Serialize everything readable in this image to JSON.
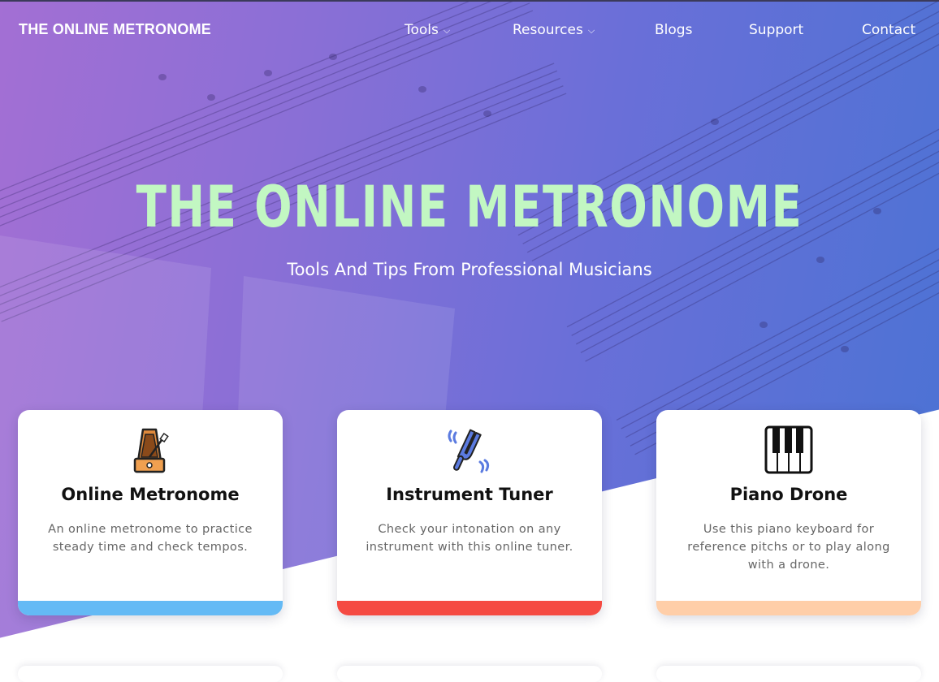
{
  "brand": "THE ONLINE METRONOME",
  "nav": [
    {
      "label": "Tools",
      "dropdown": true
    },
    {
      "label": "Resources",
      "dropdown": true
    },
    {
      "label": "Blogs",
      "dropdown": false
    },
    {
      "label": "Support",
      "dropdown": false
    },
    {
      "label": "Contact",
      "dropdown": false
    }
  ],
  "hero": {
    "title": "THE ONLINE METRONOME",
    "subtitle": "Tools And Tips From Professional Musicians"
  },
  "cards": [
    {
      "title": "Online Metronome",
      "description": "An online metronome to practice steady time and check tempos.",
      "icon": "metronome-icon",
      "accent": "#64baf5"
    },
    {
      "title": "Instrument Tuner",
      "description": "Check your intonation on any instrument with this online tuner.",
      "icon": "tuning-fork-icon",
      "accent": "#f54a42"
    },
    {
      "title": "Piano Drone",
      "description": "Use this piano keyboard for reference pitchs or to play along with a drone.",
      "icon": "piano-keys-icon",
      "accent": "#ffcea8"
    }
  ],
  "colors": {
    "hero_gradient_start": "#a36fd4",
    "hero_gradient_end": "#4a73d4",
    "title_green": "#c2f7c2"
  }
}
